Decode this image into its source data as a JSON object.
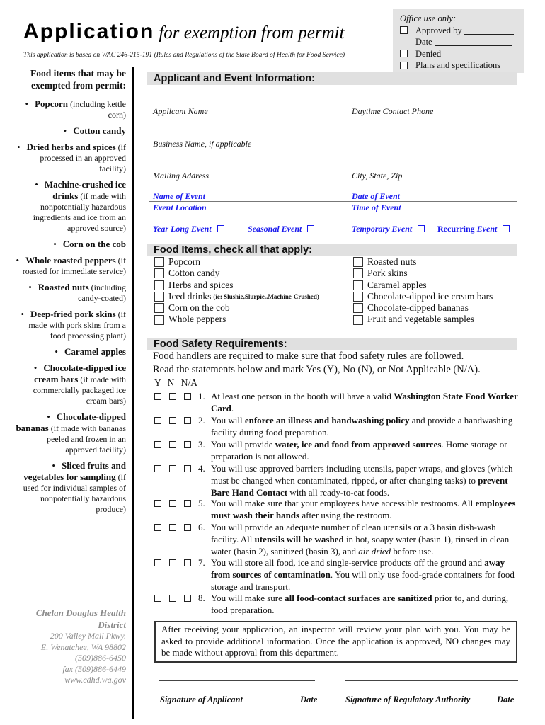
{
  "header": {
    "title_main": "Application",
    "title_sub": "for exemption from permit",
    "basis": "This application is based on WAC 246-215-191 (Rules and Regulations of the State Board of Health for Food Service)"
  },
  "office_use": {
    "heading": "Office use only:",
    "approved_by": "Approved by",
    "date": "Date",
    "denied": "Denied",
    "plans": "Plans and specifications"
  },
  "sidebar": {
    "heading": "Food items that may be exempted from permit:",
    "items": [
      {
        "name": "Popcorn",
        "note": "(including kettle corn)"
      },
      {
        "name": "Cotton candy",
        "note": ""
      },
      {
        "name": "Dried herbs and spices",
        "note": "(if processed in an approved facility)"
      },
      {
        "name": "Machine-crushed ice drinks",
        "note": "(if made with nonpotentially hazardous ingredients and ice from an approved source)"
      },
      {
        "name": "Corn on the cob",
        "note": ""
      },
      {
        "name": "Whole roasted peppers",
        "note": "(if roasted for immediate service)"
      },
      {
        "name": "Roasted nuts",
        "note": "(including candy-coated)"
      },
      {
        "name": "Deep-fried pork skins",
        "note": "(if made with pork skins from a food processing plant)"
      },
      {
        "name": "Caramel apples",
        "note": ""
      },
      {
        "name": "Chocolate-dipped ice cream bars",
        "note": "(if made with commercially packaged ice cream bars)"
      },
      {
        "name": "Chocolate-dipped bananas",
        "note": "(if made with bananas peeled and frozen in an approved facility)"
      },
      {
        "name": "Sliced fruits and vegetables for sampling",
        "note": "(if used for individual samples of nonpotentially hazardous produce)"
      }
    ]
  },
  "contact": {
    "org": "Chelan Douglas Health District",
    "address": "200 Valley Mall Pkwy.",
    "city": "E. Wenatchee, WA  98802",
    "phone": "(509)886-6450",
    "fax": "fax (509)886-6449",
    "web": "www.cdhd.wa.gov"
  },
  "applicant_section": {
    "heading": "Applicant and Event Information:",
    "applicant_name": "Applicant Name",
    "daytime_phone": "Daytime Contact Phone",
    "business_name": "Business Name, if applicable",
    "mailing_address": "Mailing Address",
    "city_state_zip": "City, State, Zip",
    "name_of_event": "Name of Event",
    "date_of_event": "Date of Event",
    "event_location": "Event Location",
    "time_of_event": "Time of Event",
    "event_types": {
      "year_long": "Year Long Event",
      "seasonal": "Seasonal Event",
      "temporary": "Temporary Event",
      "recurring_a": "Recurring",
      "recurring_b": " Event"
    }
  },
  "food_items_section": {
    "heading": "Food Items, check all that apply:",
    "left": [
      "Popcorn",
      "Cotton candy",
      "Herbs and spices",
      "Iced drinks",
      "Corn on the cob",
      "Whole peppers"
    ],
    "iced_note": "(ie: Slushie,Slurpie..Machine-Crushed)",
    "right": [
      "Roasted nuts",
      "Pork skins",
      "Caramel apples",
      "Chocolate-dipped ice cream bars",
      "Chocolate-dipped bananas",
      "Fruit and vegetable samples"
    ]
  },
  "safety_section": {
    "heading": "Food Safety Requirements:",
    "intro1": "Food handlers are required to make sure that food safety rules are followed.",
    "intro2": "Read the statements below and mark Yes (Y), No (N), or Not Applicable (N/A).",
    "col_headers": "Y  N  N/A",
    "requirements": [
      {
        "num": "1.",
        "pre": "At least one person in the booth will have a valid ",
        "bold": "Washington State Food Worker Card",
        "post": "."
      },
      {
        "num": "2.",
        "pre": "You will ",
        "bold": "enforce an illness and handwashing policy",
        "post": " and provide a handwashing facility during food preparation."
      },
      {
        "num": "3.",
        "pre": "You will provide ",
        "bold": "water, ice and food from approved sources",
        "post": ".  Home storage or preparation is not allowed."
      },
      {
        "num": "4.",
        "pre": "You will use approved barriers including utensils, paper wraps, and gloves (which must be changed when contaminated, ripped, or after changing tasks) to ",
        "bold": "prevent Bare Hand Contact",
        "post": " with all ready-to-eat foods."
      },
      {
        "num": "5.",
        "pre": "You will make sure that your employees have accessible restrooms.  All ",
        "bold": "employees must wash their hands",
        "post": " after using the restroom."
      },
      {
        "num": "6.",
        "pre": "You will provide an adequate number of clean utensils or a 3 basin dish-wash facility.  All ",
        "bold": "utensils will be washed",
        "post": " in hot, soapy water (basin 1), rinsed in clean water (basin 2), sanitized (basin 3), and ",
        "italic": "air dried",
        "post2": " before use."
      },
      {
        "num": "7.",
        "pre": "You will store all food, ice and single-service products off the ground and ",
        "bold": "away from sources of contamination",
        "post": ".  You will only use food-grade containers for food storage and transport."
      },
      {
        "num": "8.",
        "pre": "You will make sure ",
        "bold": "all food-contact surfaces are sanitized",
        "post": " prior to, and during, food preparation."
      }
    ]
  },
  "notice": "After receiving your application, an inspector will review your plan with you.  You may be asked to provide additional information.  Once the application is approved, NO changes may be made without approval from this department.",
  "signatures": {
    "applicant": "Signature of Applicant",
    "date1": "Date",
    "authority": "Signature of Regulatory Authority",
    "date2": "Date"
  }
}
